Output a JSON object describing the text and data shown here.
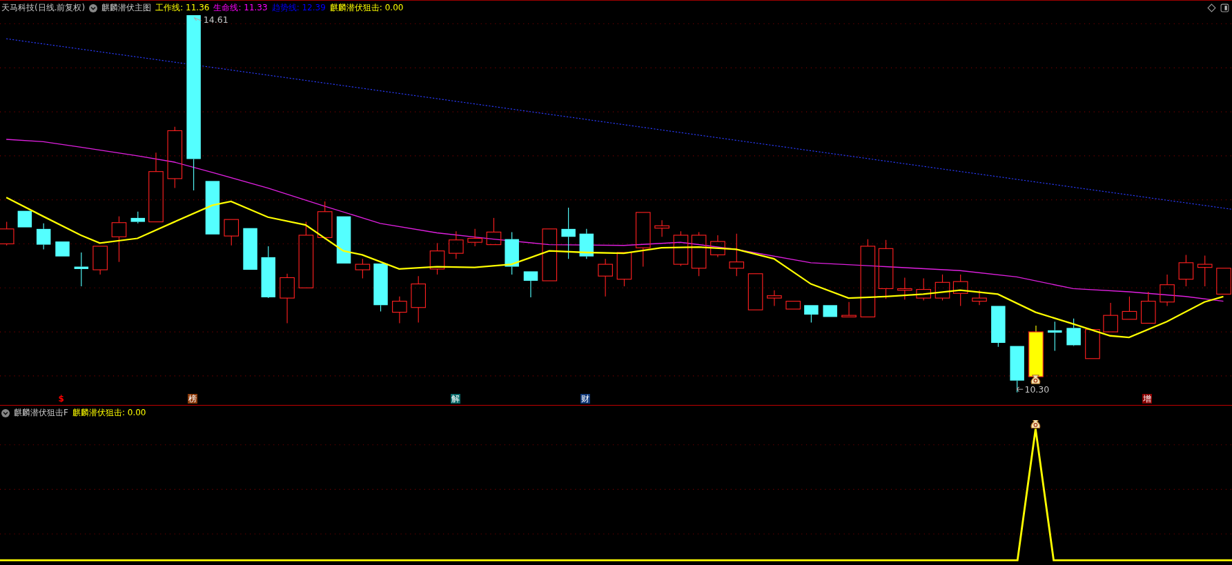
{
  "header": {
    "stock": "天马科技(日线.前复权)",
    "indicator": "麒麟潜伏主图",
    "readings": [
      {
        "label": "工作线: 11.36",
        "color": "#ffff00"
      },
      {
        "label": "生命线: 11.33",
        "color": "#ff00ff"
      },
      {
        "label": "趋势线: 12.39",
        "color": "#0000ff"
      },
      {
        "label": "麒麟潜伏狙击: 0.00",
        "color": "#ffff00"
      }
    ]
  },
  "main_chart": {
    "high_label": "14.61",
    "low_label": "10.30",
    "signals": [
      {
        "label": "$",
        "kind": "text",
        "color": "#ff0000"
      },
      {
        "label": "榜",
        "kind": "tag",
        "color": "#8b3a0a"
      },
      {
        "label": "解",
        "kind": "tag",
        "color": "#0a6b6b"
      },
      {
        "label": "财",
        "kind": "tag",
        "color": "#123a7a"
      },
      {
        "label": "增",
        "kind": "tag",
        "color": "#8b0000"
      }
    ]
  },
  "sub_chart": {
    "indicator": "麒麟潜伏狙击F",
    "readings": [
      {
        "label": "麒麟潜伏狙击: 0.00",
        "color": "#ffff00"
      }
    ]
  }
}
